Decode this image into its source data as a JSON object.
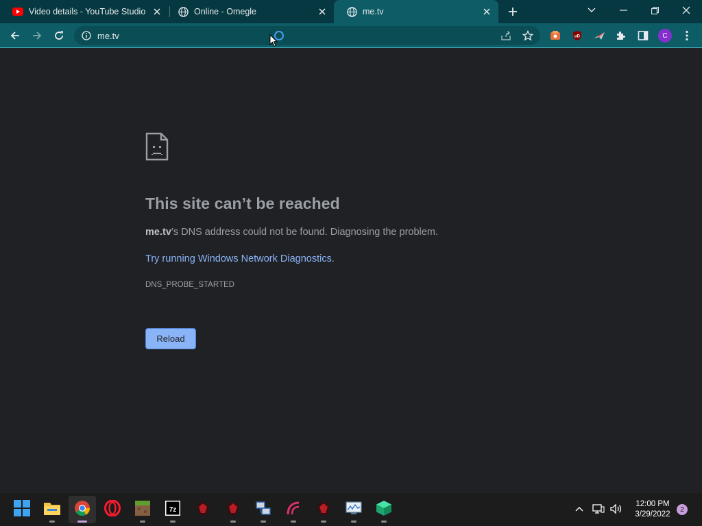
{
  "browser": {
    "tabs": [
      {
        "title": "Video details - YouTube Studio",
        "favicon": "youtube-icon",
        "active": false
      },
      {
        "title": "Online - Omegle",
        "favicon": "globe-icon",
        "active": false
      },
      {
        "title": "me.tv",
        "favicon": "globe-icon",
        "active": true
      }
    ],
    "toolbar": {
      "url": "me.tv",
      "extensions": [
        "extension-orange-icon",
        "ublock-icon",
        "extension-plane-icon",
        "puzzle-icon",
        "side-panel-icon"
      ],
      "profile_initial": "C"
    }
  },
  "error_page": {
    "title": "This site can’t be reached",
    "host": "me.tv",
    "description_rest": "’s DNS address could not be found. Diagnosing the problem.",
    "link_text": "Try running Windows Network Diagnostics",
    "link_suffix": ".",
    "error_code": "DNS_PROBE_STARTED",
    "reload_label": "Reload"
  },
  "taskbar": {
    "apps": [
      "start-icon",
      "file-explorer-icon",
      "chrome-icon",
      "opera-icon",
      "minecraft-icon",
      "7zip-icon",
      "app-red-1-icon",
      "app-red-2-icon",
      "network-app-icon",
      "pink-app-icon",
      "app-red-3-icon",
      "monitor-app-icon",
      "green-cube-icon"
    ],
    "time": "12:00 PM",
    "date": "3/29/2022",
    "notification_count": "2"
  },
  "colors": {
    "tabstrip": "#053840",
    "toolbar": "#0e5d66",
    "page_background": "#202124",
    "link": "#8ab4f8",
    "button": "#8ab4f8"
  }
}
